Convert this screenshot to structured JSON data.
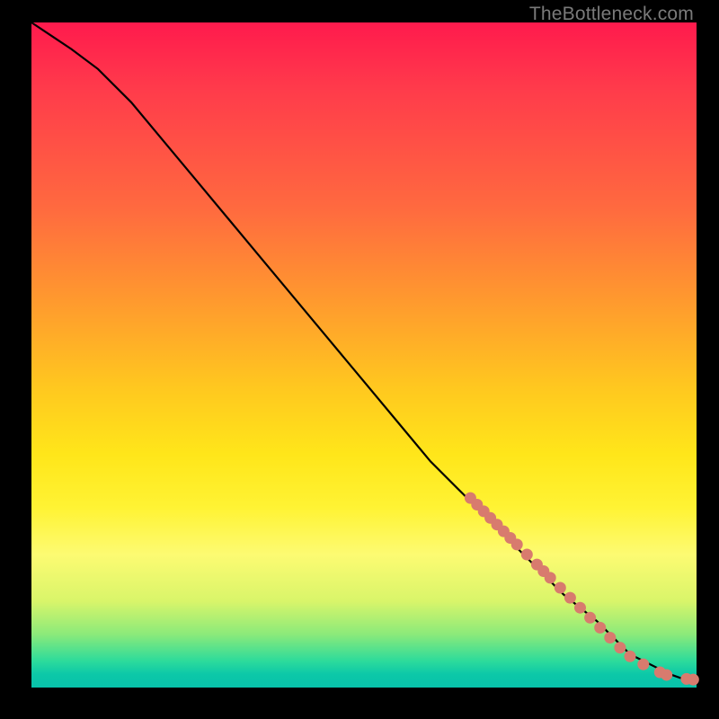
{
  "watermark": "TheBottleneck.com",
  "chart_data": {
    "type": "line",
    "title": "",
    "xlabel": "",
    "ylabel": "",
    "xlim": [
      0,
      100
    ],
    "ylim": [
      0,
      100
    ],
    "curve": {
      "x": [
        0,
        3,
        6,
        10,
        15,
        20,
        25,
        30,
        35,
        40,
        45,
        50,
        55,
        60,
        65,
        70,
        75,
        80,
        85,
        88,
        90,
        92,
        94,
        96,
        98,
        100
      ],
      "y": [
        100,
        98,
        96,
        93,
        88,
        82,
        76,
        70,
        64,
        58,
        52,
        46,
        40,
        34,
        29,
        24,
        19,
        14,
        10,
        7,
        5,
        4,
        3,
        2,
        1.3,
        1.2
      ]
    },
    "markers": [
      {
        "x": 66.0,
        "y": 28.5
      },
      {
        "x": 67.0,
        "y": 27.5
      },
      {
        "x": 68.0,
        "y": 26.5
      },
      {
        "x": 69.0,
        "y": 25.5
      },
      {
        "x": 70.0,
        "y": 24.5
      },
      {
        "x": 71.0,
        "y": 23.5
      },
      {
        "x": 72.0,
        "y": 22.5
      },
      {
        "x": 73.0,
        "y": 21.5
      },
      {
        "x": 74.5,
        "y": 20.0
      },
      {
        "x": 76.0,
        "y": 18.5
      },
      {
        "x": 77.0,
        "y": 17.5
      },
      {
        "x": 78.0,
        "y": 16.5
      },
      {
        "x": 79.5,
        "y": 15.0
      },
      {
        "x": 81.0,
        "y": 13.5
      },
      {
        "x": 82.5,
        "y": 12.0
      },
      {
        "x": 84.0,
        "y": 10.5
      },
      {
        "x": 85.5,
        "y": 9.0
      },
      {
        "x": 87.0,
        "y": 7.5
      },
      {
        "x": 88.5,
        "y": 6.0
      },
      {
        "x": 90.0,
        "y": 4.7
      },
      {
        "x": 92.0,
        "y": 3.5
      },
      {
        "x": 94.5,
        "y": 2.3
      },
      {
        "x": 95.5,
        "y": 1.9
      },
      {
        "x": 98.5,
        "y": 1.3
      },
      {
        "x": 99.5,
        "y": 1.2
      }
    ],
    "marker_color": "#d87b6e",
    "curve_color": "#000000"
  }
}
